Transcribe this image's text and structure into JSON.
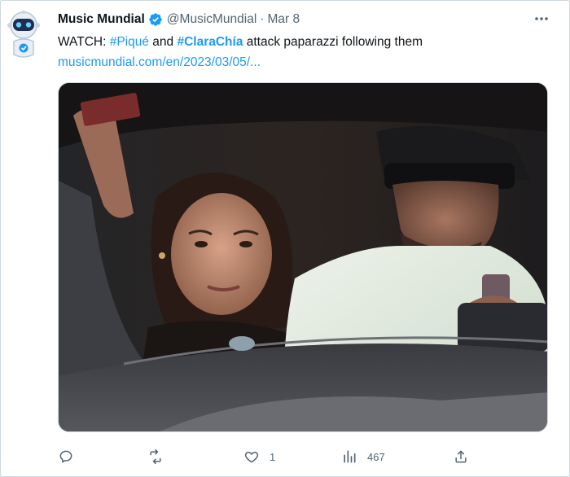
{
  "tweet": {
    "author": {
      "name": "Music Mundial",
      "handle": "@MusicMundial",
      "verified": true,
      "avatar_icon": "robot-avatar-icon"
    },
    "separator": "·",
    "date": "Mar 8",
    "text": {
      "prefix": "WATCH: ",
      "hashtag1": "#Piqué",
      "middle": " and ",
      "hashtag2": "#ClaraChía",
      "suffix": " attack paparazzi following them"
    },
    "link": "musicmundial.com/en/2023/03/05/...",
    "actions": {
      "reply": {
        "icon": "reply-icon",
        "count": ""
      },
      "retweet": {
        "icon": "retweet-icon",
        "count": ""
      },
      "like": {
        "icon": "heart-icon",
        "count": "1"
      },
      "views": {
        "icon": "views-icon",
        "count": "467"
      },
      "share": {
        "icon": "share-icon",
        "count": ""
      }
    }
  },
  "colors": {
    "accent": "#1d9bf0",
    "secondary_text": "#536471",
    "primary_text": "#0f1419"
  }
}
